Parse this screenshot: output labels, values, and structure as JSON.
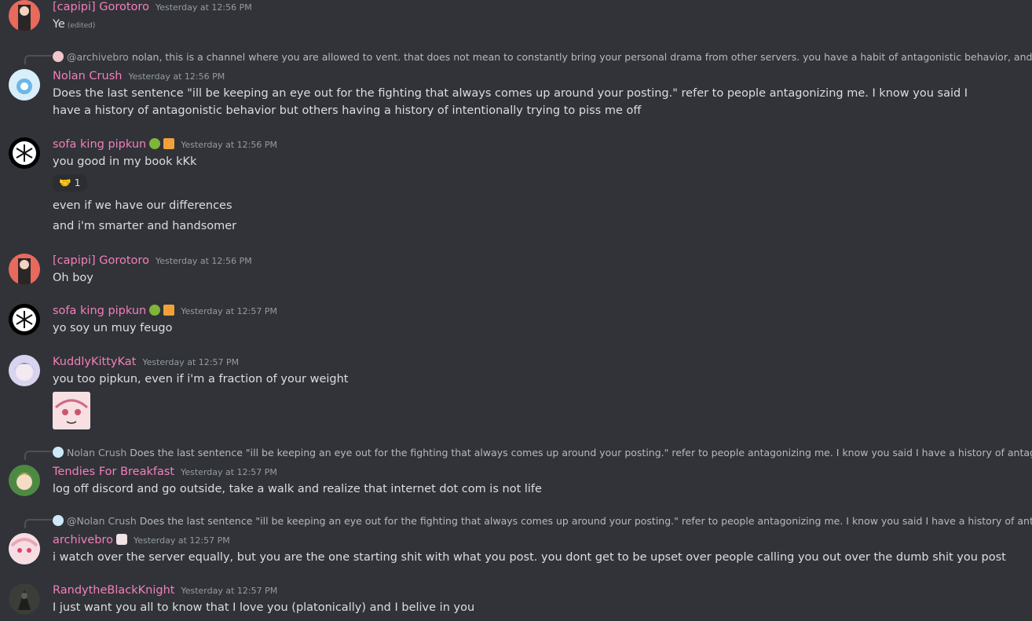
{
  "messages": [
    {
      "author": "[capipi] Gorotoro",
      "timestamp": "Yesterday at 12:56 PM",
      "lines": [
        "Ye"
      ],
      "edited": "(edited)"
    },
    {
      "reply_to": {
        "name": "@archivebro",
        "text": "nolan, this is a channel where you are allowed to vent. that does not mean to constantly bring your personal drama from other servers. you have a habit of antagonistic behavior, and bringing yo"
      },
      "author": "Nolan Crush",
      "timestamp": "Yesterday at 12:56 PM",
      "lines": [
        "Does the last sentence \"ill be keeping an eye out for the fighting that always comes up around your posting.\" refer to people antagonizing me. I know you said I have a history of antagonistic behavior but others having a history of intentionally trying to piss me off"
      ]
    },
    {
      "author": "sofa king pipkun",
      "timestamp": "Yesterday at 12:56 PM",
      "lines": [
        "you good in my book kKk",
        "even if we have our differences",
        "and i'm smarter and handsomer"
      ],
      "reaction": {
        "emoji": "🤝",
        "count": "1"
      }
    },
    {
      "author": "[capipi] Gorotoro",
      "timestamp": "Yesterday at 12:56 PM",
      "lines": [
        "Oh boy"
      ]
    },
    {
      "author": "sofa king pipkun",
      "timestamp": "Yesterday at 12:57 PM",
      "lines": [
        "yo soy un muy feugo"
      ]
    },
    {
      "author": "KuddlyKittyKat",
      "timestamp": "Yesterday at 12:57 PM",
      "lines": [
        "you too pipkun, even if i'm a fraction of your weight"
      ]
    },
    {
      "reply_to": {
        "name": "Nolan Crush",
        "text": "Does the last sentence \"ill be keeping an eye out for the fighting that always comes up around your posting.\" refer to people antagonizing me. I know you said I have a history of antagonistic beh"
      },
      "author": "Tendies For Breakfast",
      "timestamp": "Yesterday at 12:57 PM",
      "lines": [
        "log off discord and go outside, take a walk and realize that internet dot com is not life"
      ]
    },
    {
      "reply_to": {
        "name": "@Nolan Crush",
        "text": "Does the last sentence \"ill be keeping an eye out for the fighting that always comes up around your posting.\" refer to people antagonizing me. I know you said I have a history of antagonistic be"
      },
      "author": "archivebro",
      "timestamp": "Yesterday at 12:57 PM",
      "lines": [
        "i watch over the server equally, but you are the one starting shit with what you post. you dont get to be upset over people calling you out over the dumb shit you post"
      ]
    },
    {
      "author": "RandytheBlackKnight",
      "timestamp": "Yesterday at 12:57 PM",
      "lines": [
        "I just want you all to know that I love you (platonically) and I belive in you"
      ]
    }
  ],
  "colors": {
    "background": "#313338",
    "author": "#f47fbb",
    "text": "#dbdee1",
    "timestamp": "#949ba4"
  }
}
